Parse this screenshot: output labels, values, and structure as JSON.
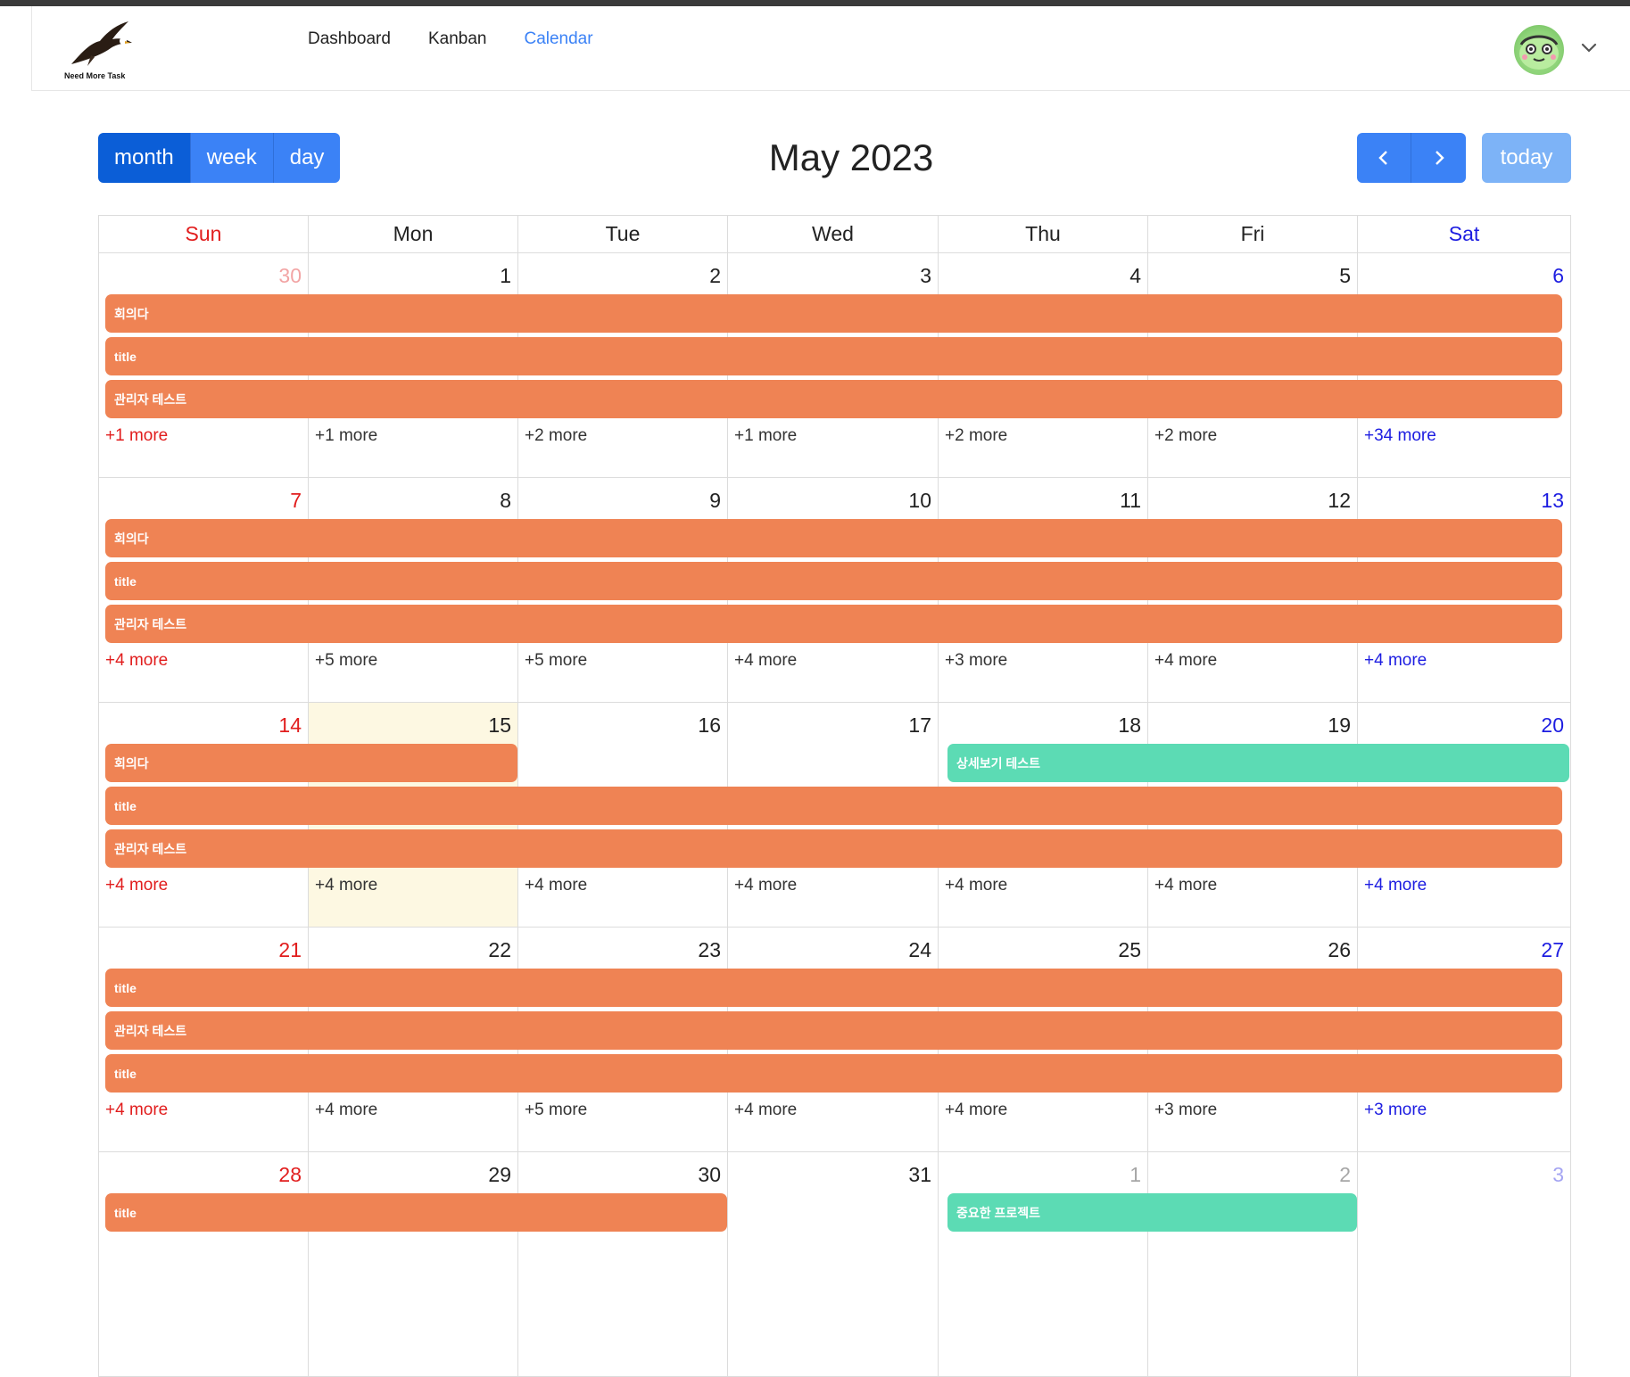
{
  "nav": {
    "logo_text": "Need More Task",
    "links": [
      {
        "label": "Dashboard",
        "active": false
      },
      {
        "label": "Kanban",
        "active": false
      },
      {
        "label": "Calendar",
        "active": true
      }
    ]
  },
  "toolbar": {
    "views": [
      {
        "label": "month",
        "active": true
      },
      {
        "label": "week",
        "active": false
      },
      {
        "label": "day",
        "active": false
      }
    ],
    "title": "May 2023",
    "today_label": "today"
  },
  "colors": {
    "primary": "#3b82f6",
    "primary_active": "#0b5ed7",
    "event_orange": "#ef8354",
    "event_green": "#5cdbb4",
    "sunday": "#e11d1d",
    "saturday": "#1d1de1",
    "today_bg": "#fdf8e2"
  },
  "weekdays": [
    "Sun",
    "Mon",
    "Tue",
    "Wed",
    "Thu",
    "Fri",
    "Sat"
  ],
  "weeks": [
    {
      "days": [
        {
          "num": "30",
          "muted": true,
          "more": "+1 more"
        },
        {
          "num": "1",
          "more": "+1 more"
        },
        {
          "num": "2",
          "more": "+2 more"
        },
        {
          "num": "3",
          "more": "+1 more"
        },
        {
          "num": "4",
          "more": "+2 more"
        },
        {
          "num": "5",
          "more": "+2 more"
        },
        {
          "num": "6",
          "more": "+34 more"
        }
      ],
      "events": [
        {
          "title": "회의다",
          "start": 0,
          "end": 6,
          "row": 0,
          "color": "orange"
        },
        {
          "title": "title",
          "start": 0,
          "end": 6,
          "row": 1,
          "color": "orange"
        },
        {
          "title": "관리자 테스트",
          "start": 0,
          "end": 6,
          "row": 2,
          "color": "orange"
        }
      ]
    },
    {
      "days": [
        {
          "num": "7",
          "more": "+4 more"
        },
        {
          "num": "8",
          "more": "+5 more"
        },
        {
          "num": "9",
          "more": "+5 more"
        },
        {
          "num": "10",
          "more": "+4 more"
        },
        {
          "num": "11",
          "more": "+3 more"
        },
        {
          "num": "12",
          "more": "+4 more"
        },
        {
          "num": "13",
          "more": "+4 more"
        }
      ],
      "events": [
        {
          "title": "회의다",
          "start": 0,
          "end": 6,
          "row": 0,
          "color": "orange"
        },
        {
          "title": "title",
          "start": 0,
          "end": 6,
          "row": 1,
          "color": "orange"
        },
        {
          "title": "관리자 테스트",
          "start": 0,
          "end": 6,
          "row": 2,
          "color": "orange"
        }
      ]
    },
    {
      "days": [
        {
          "num": "14",
          "more": "+4 more"
        },
        {
          "num": "15",
          "today": true,
          "more": "+4 more"
        },
        {
          "num": "16",
          "more": "+4 more"
        },
        {
          "num": "17",
          "more": "+4 more"
        },
        {
          "num": "18",
          "more": "+4 more"
        },
        {
          "num": "19",
          "more": "+4 more"
        },
        {
          "num": "20",
          "more": "+4 more"
        }
      ],
      "events": [
        {
          "title": "회의다",
          "start": 0,
          "end": 1,
          "row": 0,
          "color": "orange"
        },
        {
          "title": "상세보기 테스트",
          "start": 4,
          "end": 6,
          "row": 0,
          "color": "green"
        },
        {
          "title": "title",
          "start": 0,
          "end": 6,
          "row": 1,
          "color": "orange"
        },
        {
          "title": "관리자 테스트",
          "start": 0,
          "end": 6,
          "row": 2,
          "color": "orange"
        }
      ]
    },
    {
      "days": [
        {
          "num": "21",
          "more": "+4 more"
        },
        {
          "num": "22",
          "more": "+4 more"
        },
        {
          "num": "23",
          "more": "+5 more"
        },
        {
          "num": "24",
          "more": "+4 more"
        },
        {
          "num": "25",
          "more": "+4 more"
        },
        {
          "num": "26",
          "more": "+3 more"
        },
        {
          "num": "27",
          "more": "+3 more"
        }
      ],
      "events": [
        {
          "title": "title",
          "start": 0,
          "end": 6,
          "row": 0,
          "color": "orange"
        },
        {
          "title": "관리자 테스트",
          "start": 0,
          "end": 6,
          "row": 1,
          "color": "orange"
        },
        {
          "title": "title",
          "start": 0,
          "end": 6,
          "row": 2,
          "color": "orange"
        }
      ]
    },
    {
      "days": [
        {
          "num": "28",
          "more": ""
        },
        {
          "num": "29",
          "more": ""
        },
        {
          "num": "30",
          "more": ""
        },
        {
          "num": "31",
          "more": ""
        },
        {
          "num": "1",
          "muted": true,
          "more": ""
        },
        {
          "num": "2",
          "muted": true,
          "more": ""
        },
        {
          "num": "3",
          "muted": true,
          "more": ""
        }
      ],
      "events": [
        {
          "title": "title",
          "start": 0,
          "end": 2,
          "row": 0,
          "color": "orange"
        },
        {
          "title": "중요한 프로젝트",
          "start": 4,
          "end": 5,
          "row": 0,
          "color": "green"
        }
      ]
    }
  ]
}
